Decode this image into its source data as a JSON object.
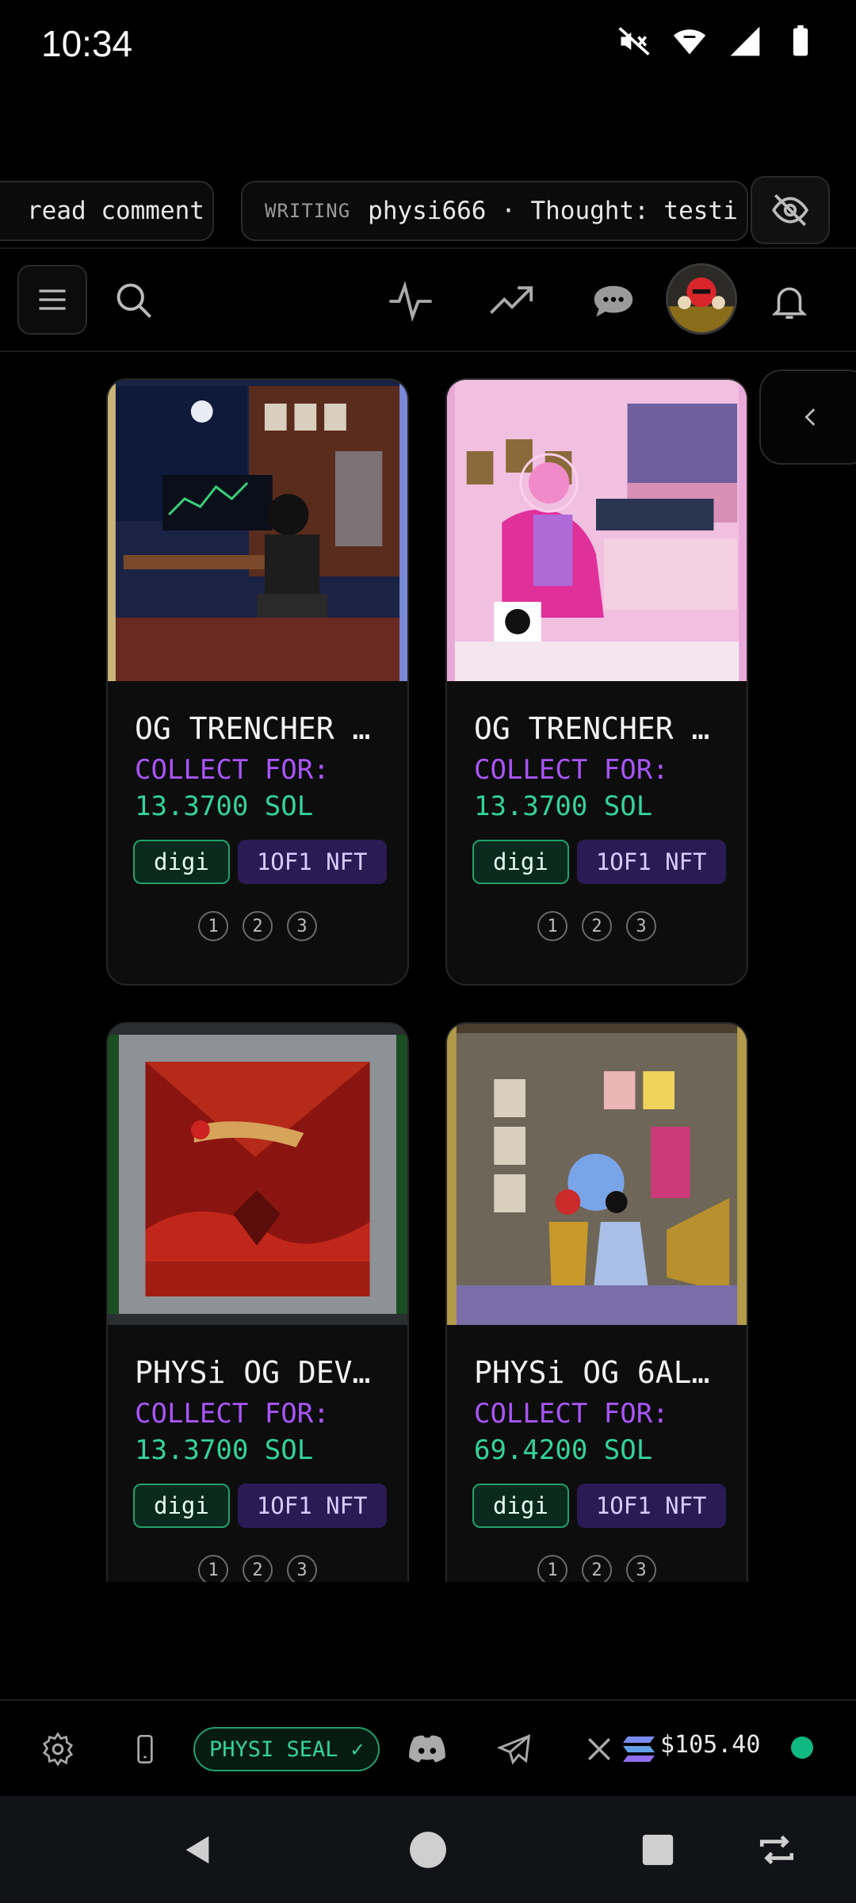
{
  "status": {
    "time": "10:34",
    "icons": [
      "mute-vibrate-icon",
      "wifi-icon",
      "cell-signal-icon",
      "battery-icon"
    ]
  },
  "ticker": {
    "left_text": "read comment",
    "tag": "WRITING",
    "main_text": "physi666 · Thought: testi"
  },
  "nav": {
    "icons": [
      "menu-icon",
      "search-icon",
      "activity-icon",
      "trending-icon",
      "chat-icon",
      "avatar",
      "bell-icon"
    ]
  },
  "cards": [
    {
      "title": "OG TRENCHER …",
      "collect_label": "COLLECT FOR:",
      "price": "13.3700 SOL",
      "tag1": "digi",
      "tag2": "1OF1 NFT",
      "pages": [
        "1",
        "2",
        "3"
      ]
    },
    {
      "title": "OG TRENCHER …",
      "collect_label": "COLLECT FOR:",
      "price": "13.3700 SOL",
      "tag1": "digi",
      "tag2": "1OF1 NFT",
      "pages": [
        "1",
        "2",
        "3"
      ]
    },
    {
      "title": "PHYSi OG DEV…",
      "collect_label": "COLLECT FOR:",
      "price": "13.3700 SOL",
      "tag1": "digi",
      "tag2": "1OF1 NFT",
      "pages": [
        "1",
        "2",
        "3"
      ]
    },
    {
      "title": "PHYSi OG 6AL…",
      "collect_label": "COLLECT FOR:",
      "price": "69.4200 SOL",
      "tag1": "digi",
      "tag2": "1OF1 NFT",
      "pages": [
        "1",
        "2",
        "3"
      ]
    }
  ],
  "bottom_bar": {
    "seal_label": "PHYSI SEAL ✓",
    "balance": "$105.40",
    "icons": [
      "settings-icon",
      "phone-icon",
      "discord-icon",
      "telegram-icon",
      "x-icon",
      "solana-icon"
    ]
  },
  "colors": {
    "accent_purple": "#a855f7",
    "price_green": "#34d399",
    "online_green": "#10b981",
    "tag_nft_bg": "#2a1b55"
  }
}
